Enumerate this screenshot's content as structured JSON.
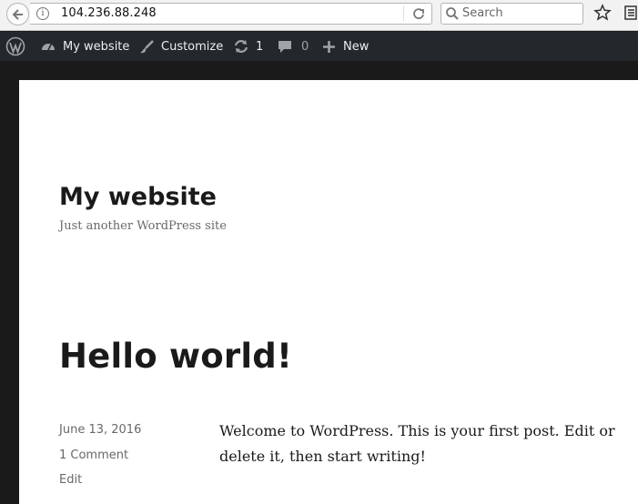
{
  "browser": {
    "url": "104.236.88.248",
    "search_placeholder": "Search"
  },
  "adminbar": {
    "site_name": "My website",
    "customize": "Customize",
    "updates_count": "1",
    "comments_count": "0",
    "new_label": "New"
  },
  "site": {
    "title": "My website",
    "tagline": "Just another WordPress site"
  },
  "post": {
    "title": "Hello world!",
    "date": "June 13, 2016",
    "comments": "1 Comment",
    "edit": "Edit",
    "content": "Welcome to WordPress. This is your first post. Edit or delete it, then start writing!"
  }
}
